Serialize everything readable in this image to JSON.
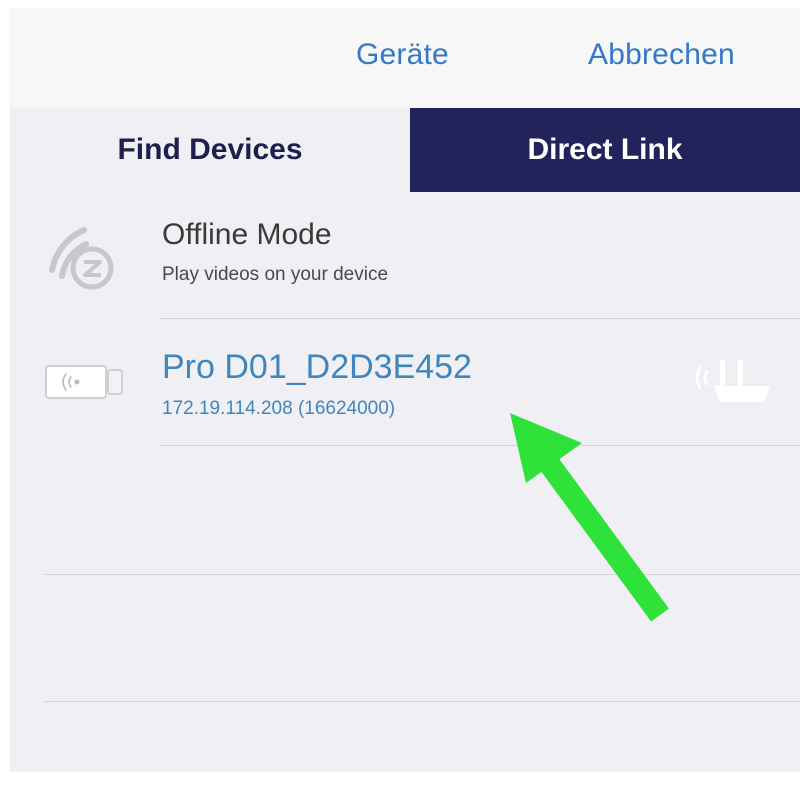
{
  "navbar": {
    "devices_label": "Geräte",
    "cancel_label": "Abbrechen"
  },
  "tabs": [
    {
      "label": "Find Devices",
      "selected": true
    },
    {
      "label": "Direct Link",
      "selected": false
    }
  ],
  "rows": {
    "offline": {
      "title": "Offline Mode",
      "subtitle": "Play videos on your device",
      "icon": "ezcast-logo-icon"
    },
    "device": {
      "title": "Pro D01_D2D3E452",
      "subtitle": "172.19.114.208 (16624000)",
      "icon": "dongle-icon",
      "status_icon": "router-icon"
    }
  },
  "annotation": {
    "icon": "green-arrow-icon",
    "color": "#2fe23a"
  },
  "colors": {
    "accent_blue": "#3478c6",
    "tab_dark": "#23235c",
    "background": "#efeff4"
  }
}
